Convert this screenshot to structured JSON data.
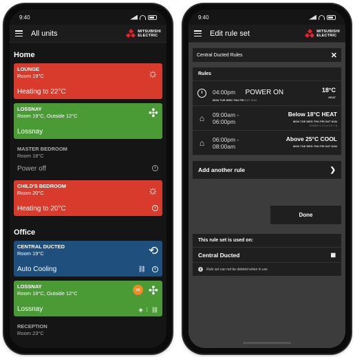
{
  "left": {
    "status_time": "9:40",
    "title": "All units",
    "brand": [
      "MITSUBISHI",
      "ELECTRIC"
    ],
    "sections": [
      {
        "label": "Home"
      },
      {
        "label": "Office"
      }
    ],
    "units": [
      {
        "name": "LOUNGE",
        "sub": "Room 19°C",
        "status": "Heating to 22°C",
        "color": "#d83b2c"
      },
      {
        "name": "LOSSNAY",
        "sub": "Room 19°C, Outside 12°C",
        "status": "Lossnay",
        "color": "#4a9a36"
      },
      {
        "name": "MASTER BEDROOM",
        "sub": "Room 18°C",
        "status": "Power off"
      },
      {
        "name": "CHILD'S BEDROOM",
        "sub": "Room 20°C",
        "status": "Heating to 20°C",
        "color": "#d83b2c"
      },
      {
        "name": "CENTRAL DUCTED",
        "sub": "Room 19°C",
        "status": "Auto Cooling",
        "color": "#1e4f7d"
      },
      {
        "name": "LOSSNAY",
        "sub": "Room 19°C, Outside 12°C",
        "status": "Lossnay",
        "color": "#4a9a36"
      },
      {
        "name": "RECEPTION",
        "sub": "Room 23°C"
      }
    ]
  },
  "right": {
    "status_time": "9:40",
    "title": "Edit rule set",
    "brand": [
      "MITSUBISHI",
      "ELECTRIC"
    ],
    "ruleset_name": "Central Ducted Rules",
    "rules_header": "Rules",
    "rules": [
      {
        "time": "04:00pm",
        "action": "POWER ON",
        "days_on": "MON TUE WED THU FRI",
        "days_off": "SAT SUN",
        "temp": "18°C",
        "mode": "HEAT"
      },
      {
        "time_from": "09:00am -",
        "time_to": "06:00pm",
        "title": "Below 18°C HEAT",
        "days": "MON TUE WED THU FRI SAT SUN",
        "zones": "ZONES 1 2 3 4 5 6 7 8"
      },
      {
        "time_from": "06:00pm -",
        "time_to": "08:00am",
        "title": "Above 25°C COOL",
        "days": "MON TUE WED THU FRI SAT SUN"
      }
    ],
    "add_rule_label": "Add another rule",
    "done_label": "Done",
    "used_on_header": "This rule set is used on:",
    "used_on_item": "Central Ducted",
    "note": "Rule set can not be deleted when in use"
  }
}
